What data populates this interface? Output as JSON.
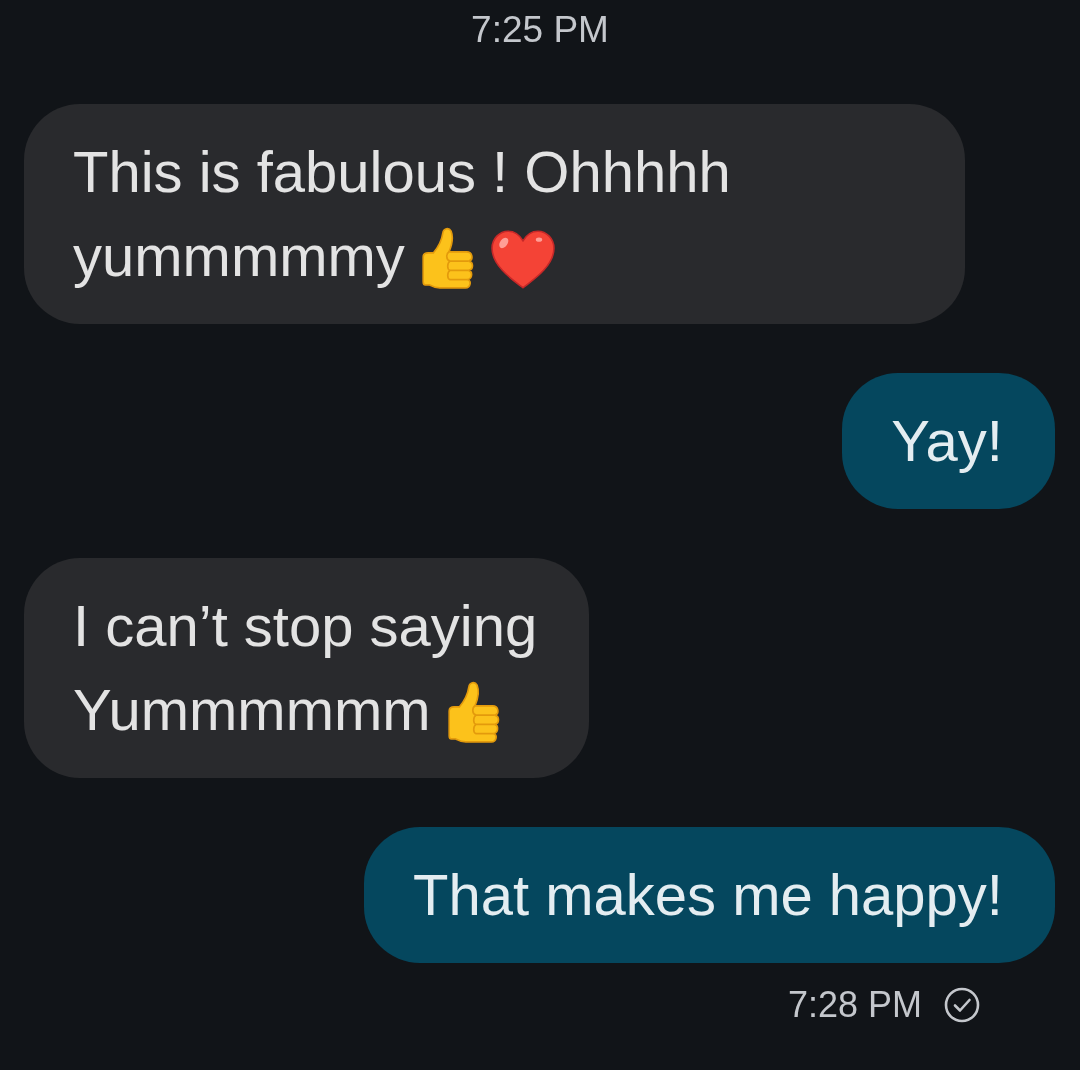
{
  "time_divider": {
    "text": "7:25 PM"
  },
  "messages": [
    {
      "kind": "incoming",
      "hard_breaks": false,
      "lines": [
        "This is fabulous ! Ohhhhh",
        "yummmmmy"
      ],
      "emojis": [
        {
          "kind": "thumbs_up"
        },
        {
          "kind": "heart"
        }
      ]
    },
    {
      "kind": "outgoing",
      "lines": [
        "Yay!"
      ]
    },
    {
      "kind": "incoming",
      "hard_breaks": true,
      "lines": [
        "I can’t stop saying",
        "Yummmmmm"
      ],
      "emojis": [
        {
          "kind": "thumbs_up"
        }
      ]
    },
    {
      "kind": "outgoing",
      "lines": [
        "That makes me happy!"
      ]
    }
  ],
  "status": {
    "time": "7:28 PM",
    "delivered": true
  }
}
